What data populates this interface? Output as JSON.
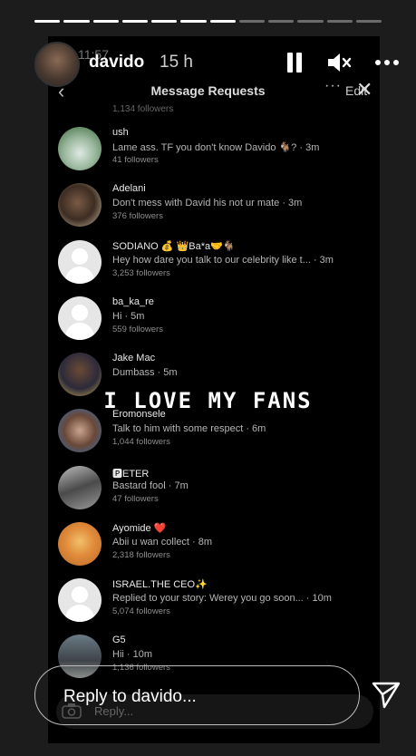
{
  "story": {
    "username": "davido",
    "time_ago": "15 h",
    "caption": "I LOVE MY FANS",
    "reply_placeholder": "Reply to davido..."
  },
  "screenshot": {
    "clock": "11:57",
    "battery": "",
    "header_title": "Message Requests",
    "edit_label": "Edit",
    "inner_reply_placeholder": "Reply...",
    "top_partial": "1,134 followers",
    "requests": [
      {
        "name": "ush",
        "message": "Lame ass. TF you don't know Davido 🐐? · 3m",
        "followers": "41 followers",
        "avatar": "photo"
      },
      {
        "name": "Adelani",
        "message": "Don't mess with David his not ur mate · 3m",
        "followers": "376 followers",
        "avatar": "photo"
      },
      {
        "name": "SODIANO 💰 👑Ba*a🤝🐐",
        "message": "Hey how dare you talk to our celebrity like t... · 3m",
        "followers": "3,253 followers",
        "avatar": "default"
      },
      {
        "name": "ba_ka_re",
        "message": "Hi · 5m",
        "followers": "559 followers",
        "avatar": "default"
      },
      {
        "name": "Jake Mac",
        "message": "Dumbass · 5m",
        "followers": "",
        "avatar": "photo"
      },
      {
        "name": "Eromonsele",
        "message": "Talk to him with some respect · 6m",
        "followers": "1,044 followers",
        "avatar": "photo"
      },
      {
        "name": "🅿ETER",
        "message": "Bastard fool · 7m",
        "followers": "47 followers",
        "avatar": "photo"
      },
      {
        "name": "Ayomide ❤️",
        "message": "Abii u wan collect · 8m",
        "followers": "2,318 followers",
        "avatar": "photo"
      },
      {
        "name": "ISRAEL.THE CEO✨",
        "message": "Replied to your story: Werey you go soon...  · 10m",
        "followers": "5,074 followers",
        "avatar": "default"
      },
      {
        "name": "G5",
        "message": "Hii · 10m",
        "followers": "1,136 followers",
        "avatar": "photo"
      }
    ]
  }
}
